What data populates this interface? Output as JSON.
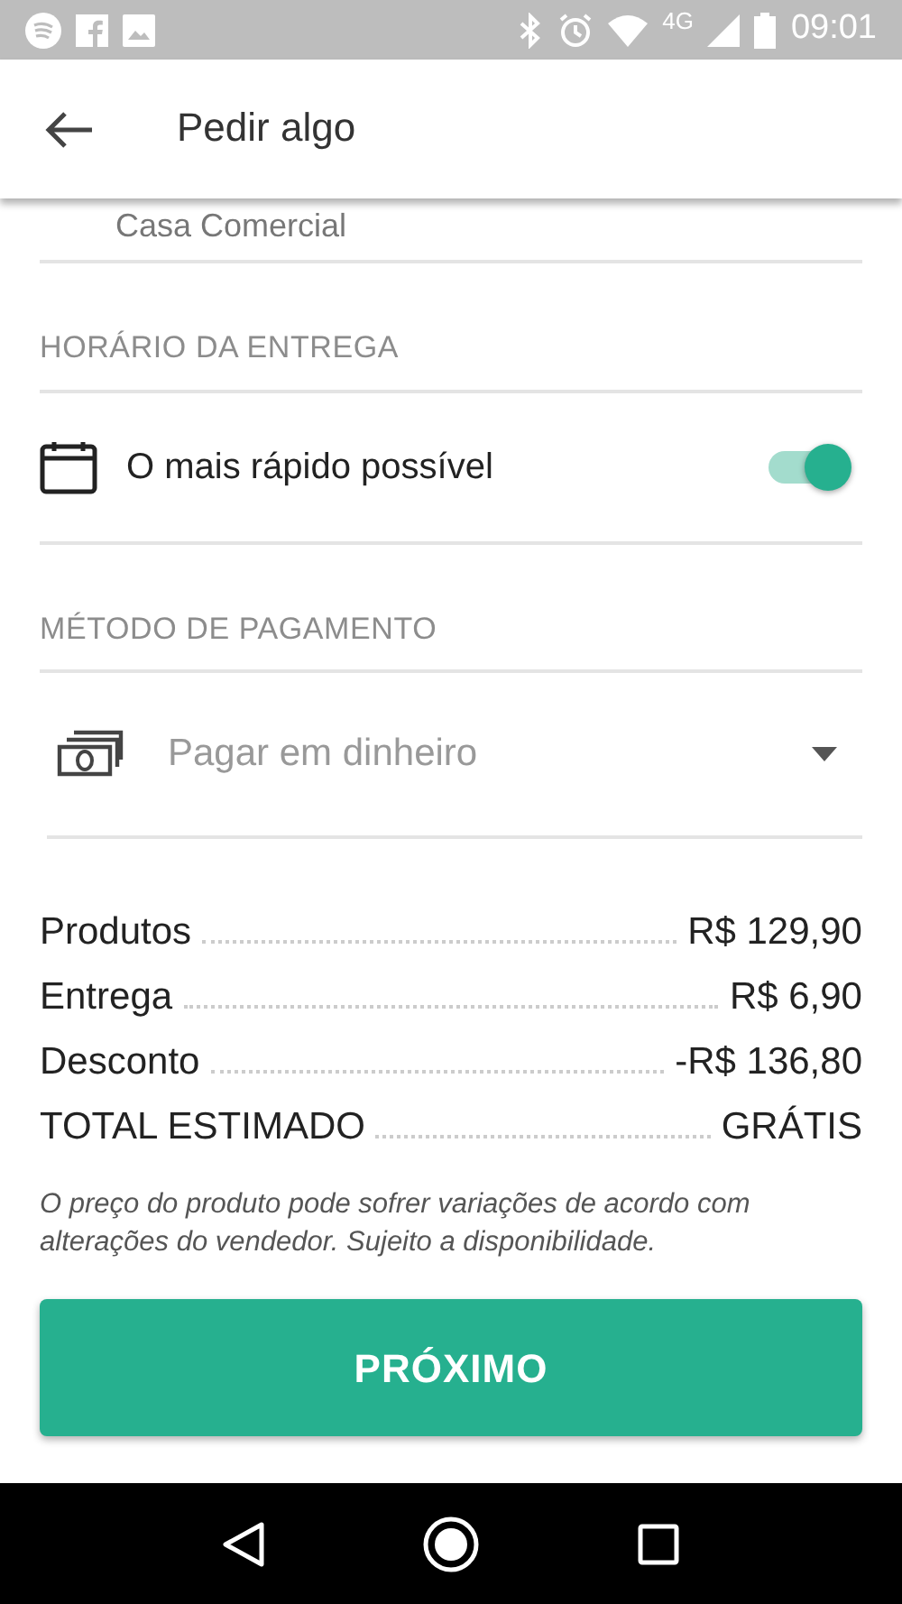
{
  "status_bar": {
    "network": "4G",
    "time": "09:01"
  },
  "app_bar": {
    "title": "Pedir algo"
  },
  "address": {
    "text": "Casa Comercial"
  },
  "delivery": {
    "heading": "HORÁRIO DA ENTREGA",
    "label": "O mais rápido possível",
    "on": true
  },
  "payment": {
    "heading": "MÉTODO DE PAGAMENTO",
    "placeholder": "Pagar em dinheiro"
  },
  "summary": [
    {
      "label": "Produtos",
      "value": "R$ 129,90"
    },
    {
      "label": "Entrega",
      "value": "R$ 6,90"
    },
    {
      "label": "Desconto",
      "value": "-R$ 136,80"
    },
    {
      "label": "TOTAL ESTIMADO",
      "value": "GRÁTIS"
    }
  ],
  "note": "O preço do produto pode sofrer variações de acordo com alterações do vendedor. Sujeito a disponibilidade.",
  "next_button": "PRÓXIMO"
}
